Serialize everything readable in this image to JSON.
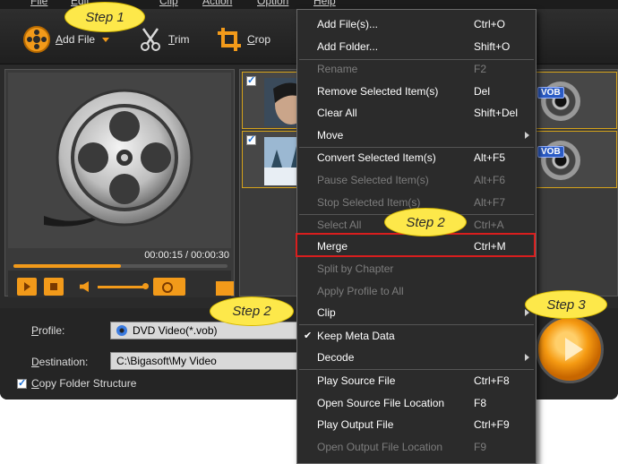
{
  "menubar": {
    "items": [
      "File",
      "Edit",
      "Clip",
      "Action",
      "Option",
      "Help"
    ]
  },
  "toolbar": {
    "add_file": "Add File",
    "trim": "Trim",
    "crop": "Crop"
  },
  "preview": {
    "time": "00:00:15 / 00:00:30",
    "progress": 0.5
  },
  "files": [
    {
      "format": "VOB"
    },
    {
      "format": "VOB"
    }
  ],
  "bottom": {
    "profile_label": "Profile:",
    "profile_value": "DVD Video(*.vob)",
    "destination_label": "Destination:",
    "destination_value": "C:\\Bigasoft\\My Video",
    "copy_folder_label": "Copy Folder Structure"
  },
  "menu": {
    "items": [
      {
        "label": "Add File(s)...",
        "shortcut": "Ctrl+O",
        "disabled": false
      },
      {
        "label": "Add Folder...",
        "shortcut": "Shift+O",
        "disabled": false
      },
      {
        "label": "Rename",
        "shortcut": "F2",
        "disabled": true
      },
      {
        "label": "Remove Selected Item(s)",
        "shortcut": "Del",
        "disabled": false
      },
      {
        "label": "Clear All",
        "shortcut": "Shift+Del",
        "disabled": false
      },
      {
        "label": "Move",
        "shortcut": "",
        "disabled": false,
        "submenu": true
      },
      {
        "label": "Convert Selected Item(s)",
        "shortcut": "Alt+F5",
        "disabled": false
      },
      {
        "label": "Pause Selected Item(s)",
        "shortcut": "Alt+F6",
        "disabled": true
      },
      {
        "label": "Stop Selected Item(s)",
        "shortcut": "Alt+F7",
        "disabled": true
      },
      {
        "label": "Select All",
        "shortcut": "Ctrl+A",
        "disabled": true
      },
      {
        "label": "Merge",
        "shortcut": "Ctrl+M",
        "disabled": false
      },
      {
        "label": "Split by Chapter",
        "shortcut": "",
        "disabled": true
      },
      {
        "label": "Apply Profile to All",
        "shortcut": "",
        "disabled": true
      },
      {
        "label": "Clip",
        "shortcut": "",
        "disabled": false,
        "submenu": true
      },
      {
        "label": "Keep Meta Data",
        "shortcut": "",
        "disabled": false,
        "checked": true
      },
      {
        "label": "Decode",
        "shortcut": "",
        "disabled": false,
        "submenu": true
      },
      {
        "label": "Play Source File",
        "shortcut": "Ctrl+F8",
        "disabled": false
      },
      {
        "label": "Open Source File Location",
        "shortcut": "F8",
        "disabled": false
      },
      {
        "label": "Play Output File",
        "shortcut": "Ctrl+F9",
        "disabled": false
      },
      {
        "label": "Open Output File Location",
        "shortcut": "F9",
        "disabled": true
      }
    ]
  },
  "callouts": {
    "step1": "Step 1",
    "step2_menu": "Step 2",
    "step2_profile": "Step 2",
    "step3": "Step 3"
  },
  "colors": {
    "accent": "#f29a1a",
    "highlight_border": "#d91e1e",
    "callout": "#fde84a"
  }
}
